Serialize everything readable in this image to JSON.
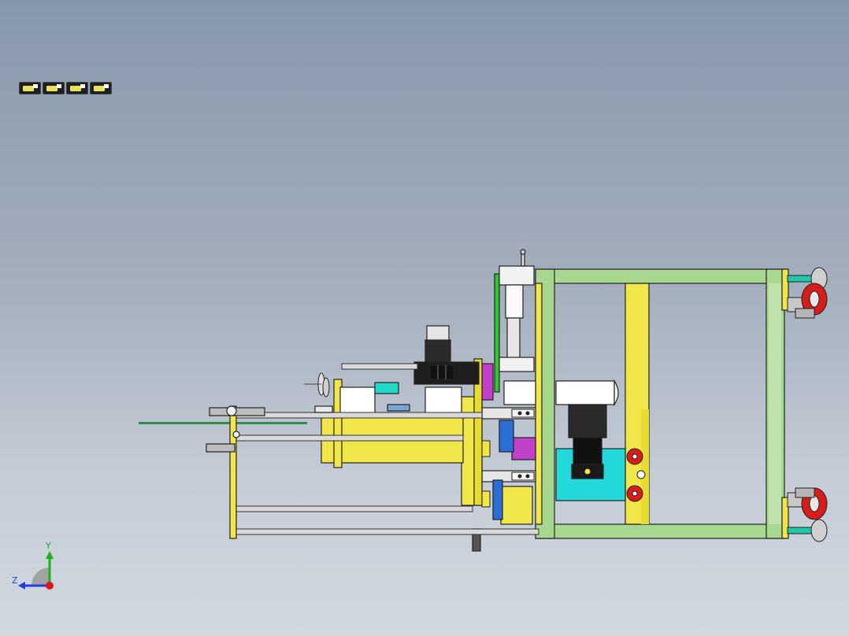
{
  "viewport": {
    "background": "#8fa0b4"
  },
  "toolbar": {
    "items": [
      {
        "name": "view-orientation-icon"
      },
      {
        "name": "display-style-icon"
      },
      {
        "name": "section-view-icon"
      },
      {
        "name": "hide-show-icon"
      }
    ]
  },
  "model": {
    "frame_color": "#a8d890",
    "plate_color": "#f0e64a",
    "caster_color": "#d81c1c",
    "motor_color": "#1e1e1e",
    "accent_cyan": "#23d8d8",
    "accent_magenta": "#c23fc9",
    "accent_blue": "#2a6fd6"
  },
  "triad": {
    "x_axis_label": "Z",
    "y_axis_label": "Y",
    "x_color": "#1f3fe0",
    "y_color": "#19b019",
    "origin_color": "#e0141e"
  }
}
